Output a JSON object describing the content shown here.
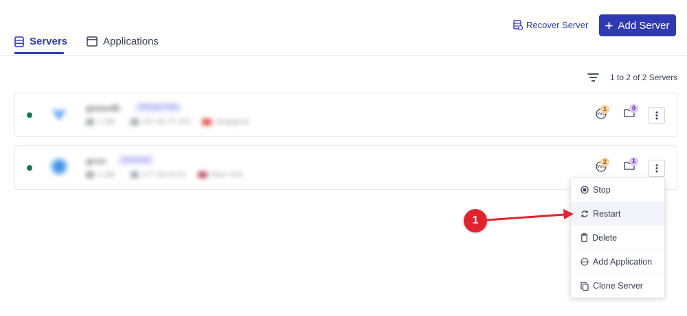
{
  "tabs": [
    {
      "label": "Servers",
      "active": true
    },
    {
      "label": "Applications",
      "active": false
    }
  ],
  "header": {
    "recover_label": "Recover Server",
    "add_label": "Add Server",
    "add_icon": "plus-icon"
  },
  "list": {
    "count_text": "1 to 2 of 2 Servers"
  },
  "servers": [
    {
      "name": "gmaxdb",
      "tag": "REDACTED",
      "meta_a": "1 GB",
      "meta_b": "157.90.77.223",
      "meta_c": "Singapore",
      "status_color": "#0d7a52",
      "apps_count": "1",
      "folders_count": "0"
    },
    {
      "name": "gcsx",
      "tag": "Personal",
      "meta_a": "1 GB",
      "meta_b": "177.83.02.01",
      "meta_c": "New York",
      "status_color": "#0d7a52",
      "apps_count": "2",
      "folders_count": "1"
    }
  ],
  "menu": {
    "items": [
      {
        "label": "Stop",
        "icon": "stop-icon"
      },
      {
        "label": "Restart",
        "icon": "restart-icon"
      },
      {
        "label": "Delete",
        "icon": "trash-icon"
      },
      {
        "label": "Add Application",
        "icon": "www-icon"
      },
      {
        "label": "Clone Server",
        "icon": "copy-icon"
      }
    ]
  },
  "annotation": {
    "step": "1"
  },
  "colors": {
    "accent": "#2f3ab2",
    "annotation_red": "#e0232e",
    "apps_badge": "#f8d29f",
    "folders_badge": "#dbc6f3"
  }
}
